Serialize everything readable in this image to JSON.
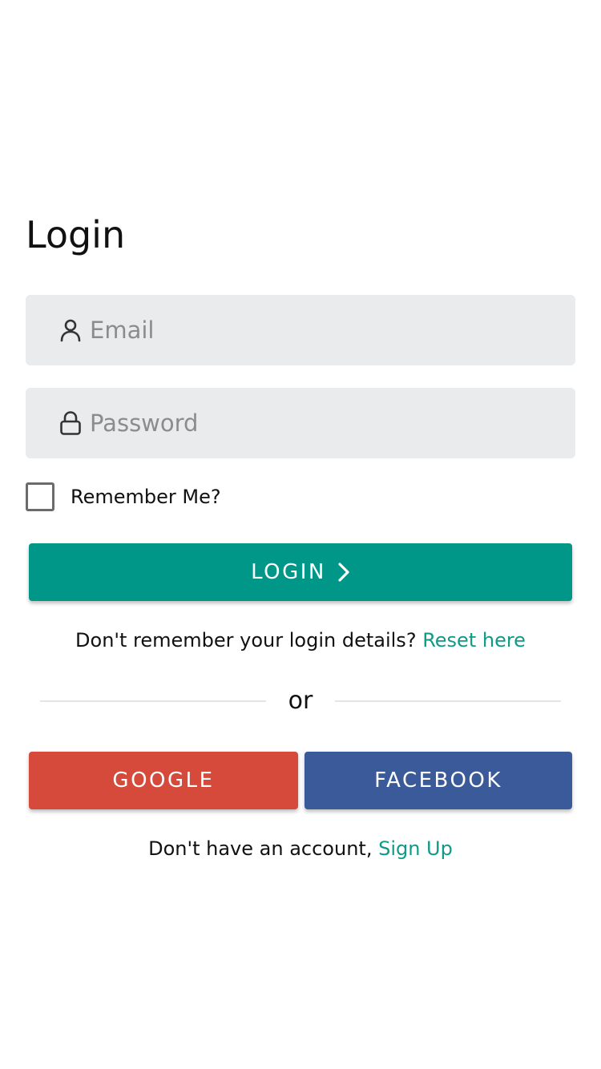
{
  "page": {
    "title": "Login"
  },
  "form": {
    "email": {
      "placeholder": "Email",
      "value": "",
      "icon": "user-icon"
    },
    "password": {
      "placeholder": "Password",
      "value": "",
      "icon": "lock-icon"
    },
    "remember": {
      "label": "Remember Me?",
      "checked": false
    },
    "login_button": {
      "label": "LOGIN",
      "icon": "chevron-right-icon"
    }
  },
  "reset": {
    "prompt": "Don't remember your login details? ",
    "link": "Reset here"
  },
  "divider": {
    "label": "or"
  },
  "social": {
    "google_label": "GOOGLE",
    "facebook_label": "FACEBOOK"
  },
  "signup": {
    "prompt": "Don't have an account, ",
    "link": "Sign Up"
  },
  "colors": {
    "accent": "#009688",
    "link": "#0f9a88",
    "google": "#d54a3a",
    "facebook": "#3b5a9a",
    "field_background": "#eaebed"
  }
}
